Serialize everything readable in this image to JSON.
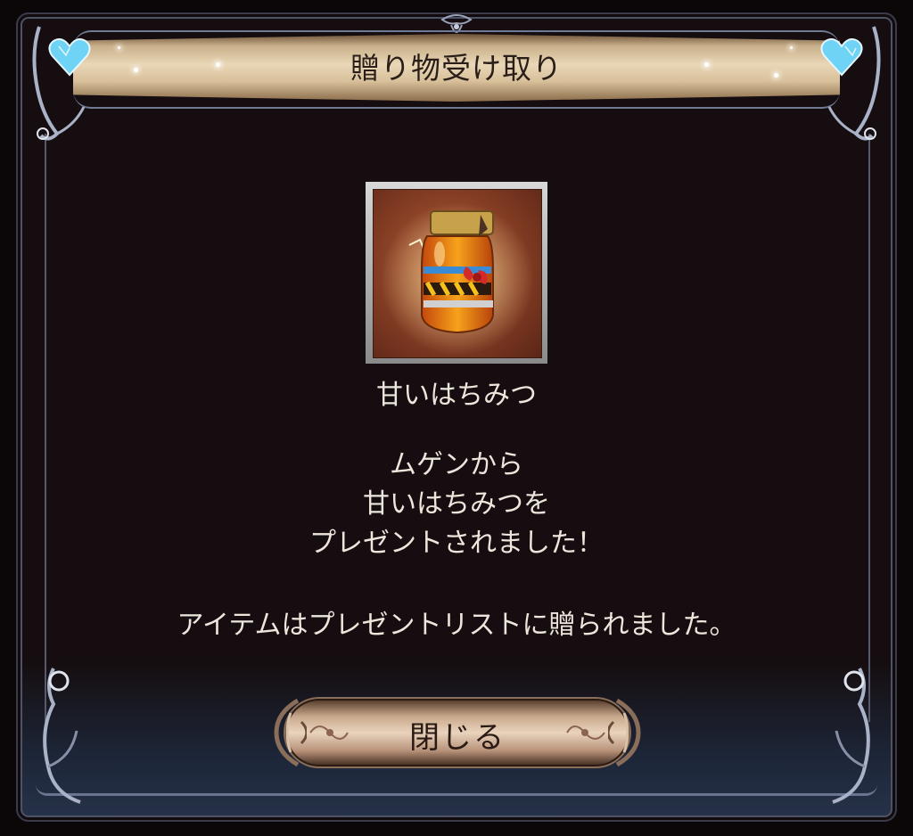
{
  "dialog": {
    "title": "贈り物受け取り",
    "item_name": "甘いはちみつ",
    "message_lines": [
      "ムゲンから",
      "甘いはちみつを",
      "プレゼントされました！"
    ],
    "notice": "アイテムはプレゼントリストに贈られました。",
    "close_label": "閉じる"
  },
  "icons": {
    "item": "honey-jar-icon",
    "corner_left": "blue-heart-gem-icon",
    "corner_right": "blue-heart-gem-icon"
  },
  "colors": {
    "background": "#150d0f",
    "text": "#ece6dc",
    "ribbon": "#e9d7b7",
    "button": "#e9d3bd",
    "gem": "#6fd3f5"
  }
}
